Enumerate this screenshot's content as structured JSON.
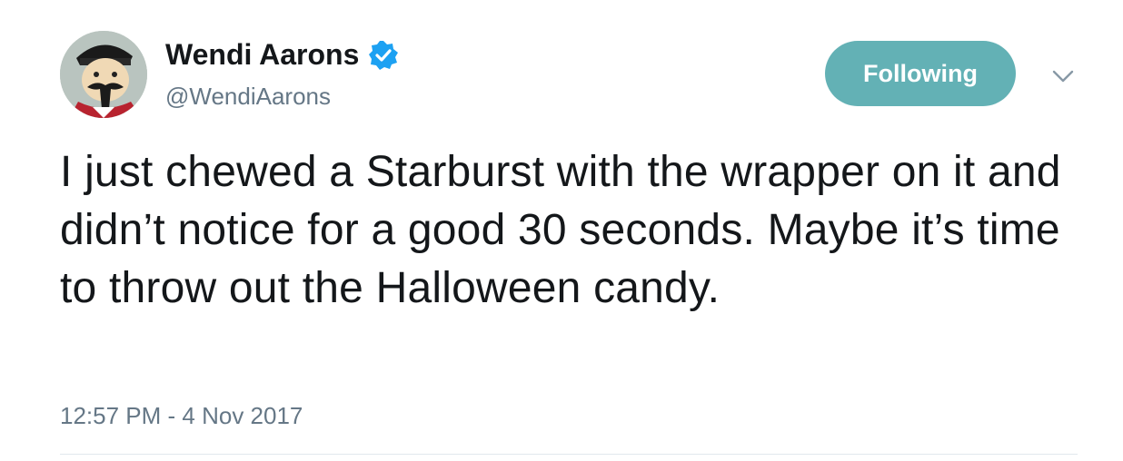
{
  "author": {
    "name": "Wendi Aarons",
    "handle": "@WendiAarons",
    "verified": true,
    "avatar_icon": "cartoon-character-avatar"
  },
  "follow_button": {
    "label": "Following",
    "color": "#63b1b5"
  },
  "menu": {
    "icon": "chevron-down-icon"
  },
  "tweet": {
    "text": "I just chewed a Starburst with the wrapper on it and didn’t notice for a good 30 seconds. Maybe it’s time to throw out the Halloween candy.",
    "timestamp": "12:57 PM - 4 Nov 2017"
  },
  "colors": {
    "verified_badge": "#1da1f2",
    "secondary_text": "#657786",
    "primary_text": "#14171a"
  }
}
